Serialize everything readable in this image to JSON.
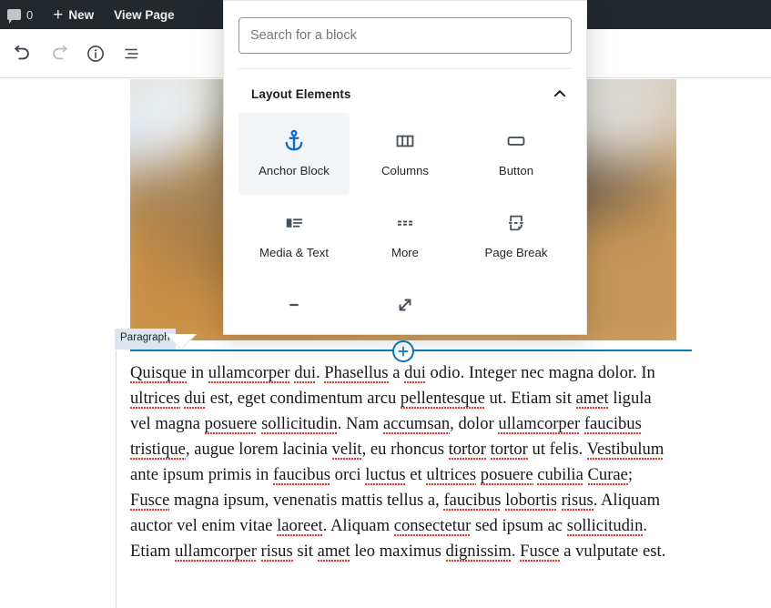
{
  "adminbar": {
    "comment_icon": "comment-bubble-icon",
    "comment_count": "0",
    "new_label": "New",
    "view_page_label": "View Page"
  },
  "editor_toolbar": {
    "undo": "undo-icon",
    "redo": "redo-icon",
    "info": "info-icon",
    "list_view": "list-view-icon"
  },
  "inserter": {
    "search": {
      "placeholder": "Search for a block",
      "value": ""
    },
    "panel": {
      "title": "Layout Elements",
      "collapse_icon": "chevron-up-icon"
    },
    "blocks": [
      {
        "label": "Anchor Block",
        "icon": "anchor-icon",
        "selected": true
      },
      {
        "label": "Columns",
        "icon": "columns-icon",
        "selected": false
      },
      {
        "label": "Button",
        "icon": "button-icon",
        "selected": false
      },
      {
        "label": "Media & Text",
        "icon": "media-text-icon",
        "selected": false
      },
      {
        "label": "More",
        "icon": "more-icon",
        "selected": false
      },
      {
        "label": "Page Break",
        "icon": "page-break-icon",
        "selected": false
      },
      {
        "label": "",
        "icon": "separator-icon",
        "selected": false
      },
      {
        "label": "",
        "icon": "spacer-icon",
        "selected": false
      },
      {
        "label": "",
        "icon": "",
        "selected": false
      }
    ]
  },
  "canvas": {
    "featured_image": "blurred-bokeh-photo",
    "block_inserter_icon": "plus-circle-icon",
    "block_label": "Paragraph",
    "paragraph": "Quisque in ullamcorper dui. Phasellus a dui odio. Integer nec magna dolor. In ultrices dui est, eget condimentum arcu pellentesque ut. Etiam sit amet ligula vel magna posuere sollicitudin. Nam accumsan, dolor ullamcorper faucibus tristique, augue lorem lacinia velit, eu rhoncus tortor tortor ut felis. Vestibulum ante ipsum primis in faucibus orci luctus et ultrices posuere cubilia Curae; Fusce magna ipsum, venenatis mattis tellus a, faucibus lobortis risus. Aliquam auctor vel enim vitae laoreet. Aliquam consectetur sed ipsum ac sollicitudin. Etiam ullamcorper risus sit amet leo maximus dignissim. Fusce a vulputate est.",
    "misspelled_words": [
      "Quisque",
      "ullamcorper",
      "dui",
      "Phasellus",
      "dui",
      "ultrices",
      "dui",
      "pellentesque",
      "amet",
      "posuere",
      "sollicitudin",
      "accumsan",
      "ullamcorper",
      "faucibus",
      "tristique",
      "velit",
      "tortor",
      "tortor",
      "Vestibulum",
      "faucibus",
      "luctus",
      "ultrices",
      "posuere",
      "cubilia",
      "Curae",
      "Fusce",
      "faucibus",
      "lobortis",
      "risus",
      "laoreet",
      "consectetur",
      "sollicitudin",
      "ullamcorper",
      "risus",
      "amet",
      "dignissim",
      "Fusce"
    ]
  },
  "colors": {
    "adminbar_bg": "#23282d",
    "accent_blue": "#0a7aba",
    "icon_blue": "#0b69c7",
    "selected_bg": "#f3f4f5",
    "tag_bg": "#dce5ee",
    "spellcheck_red": "#e0342c"
  }
}
